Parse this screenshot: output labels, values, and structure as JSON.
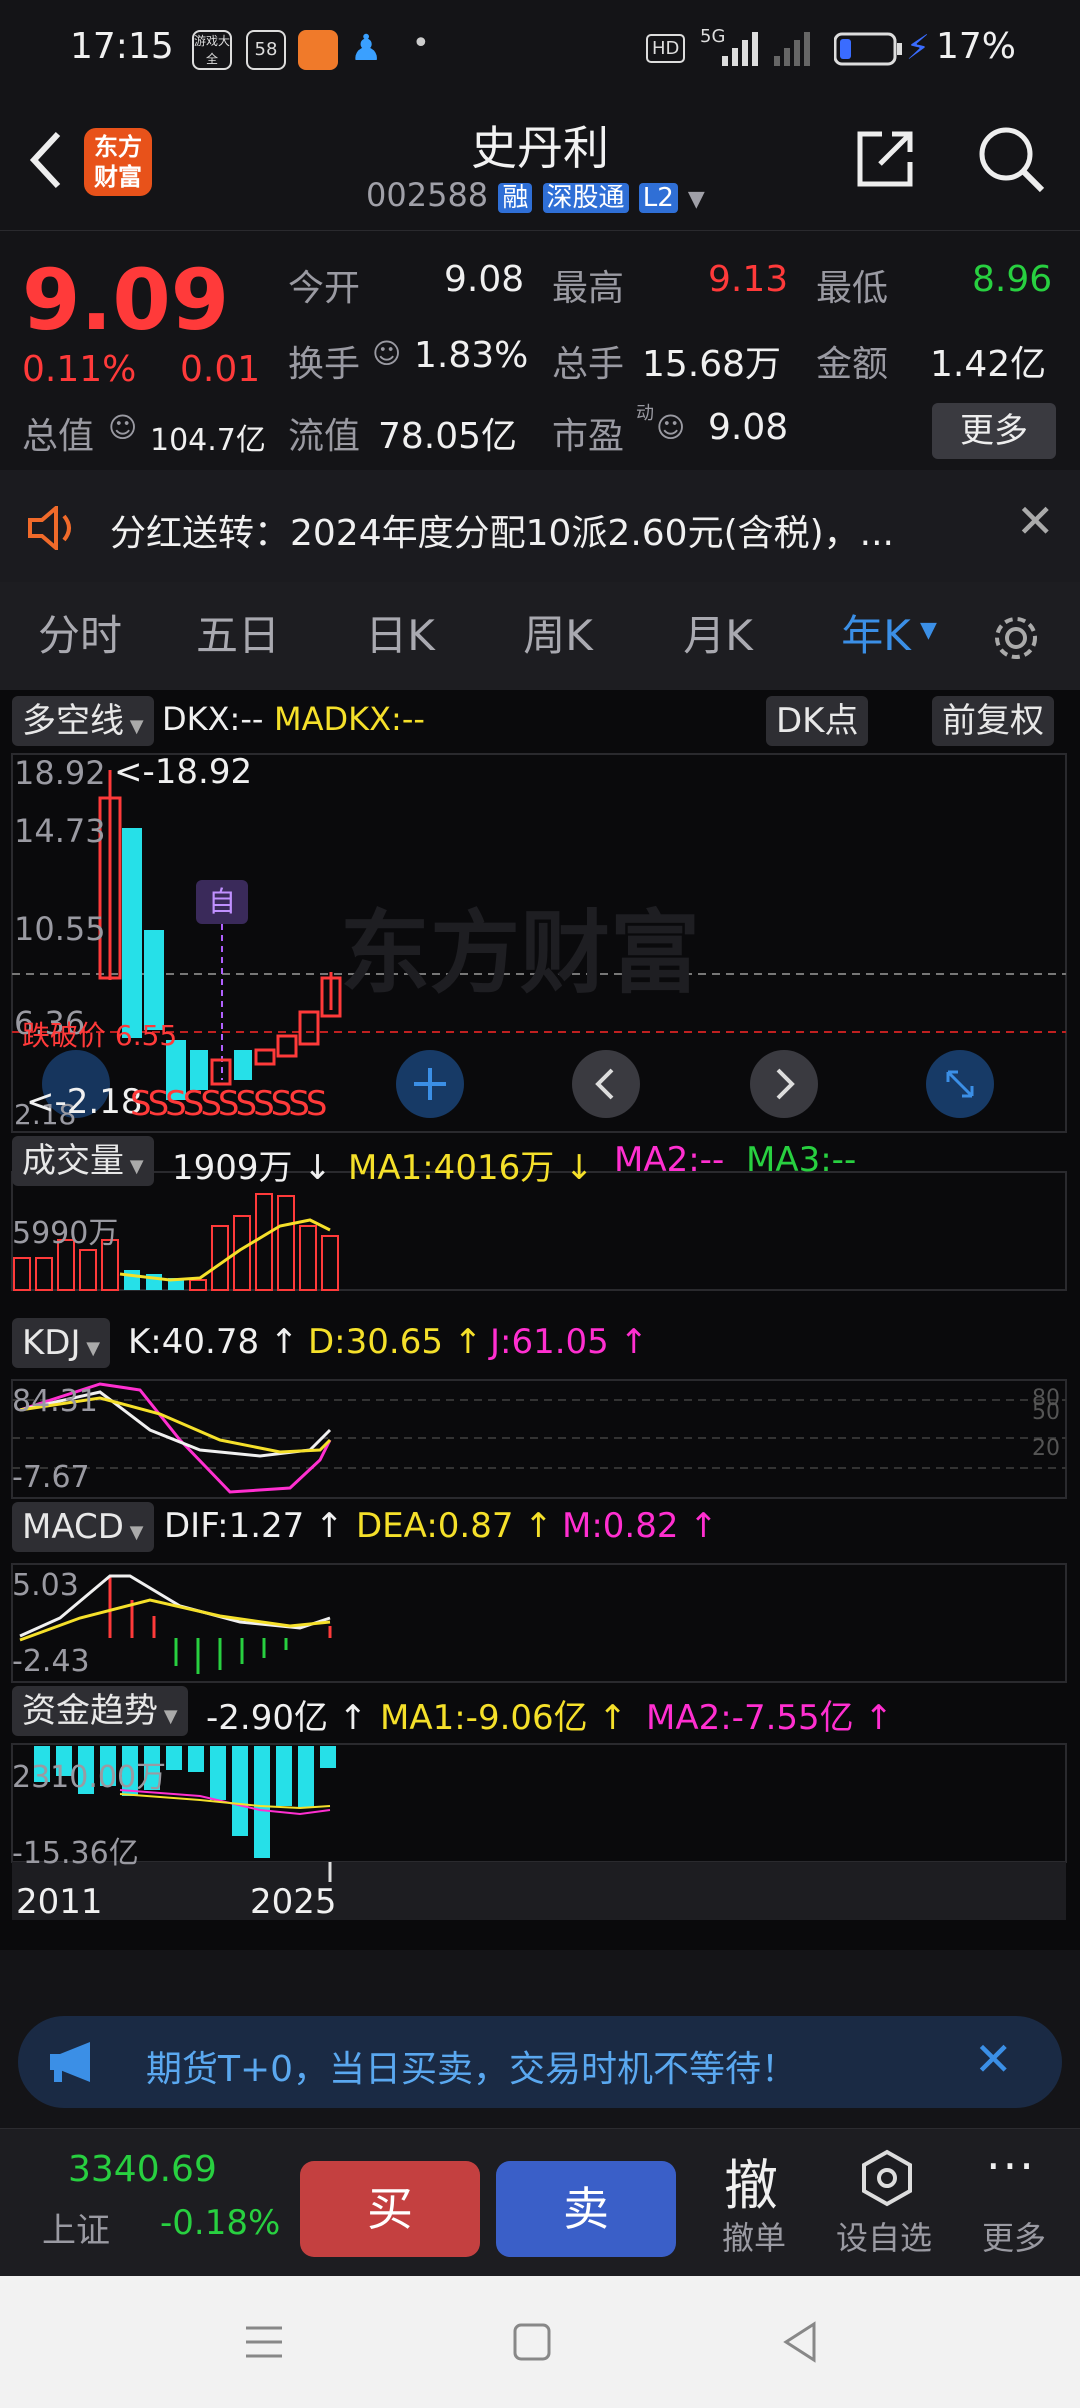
{
  "status": {
    "time": "17:15",
    "battery": "17%",
    "app_badge_1": "游戏大全",
    "app_badge_2": "58",
    "signal": "5G"
  },
  "header": {
    "title": "史丹利",
    "code": "002588",
    "tag_margin": "融",
    "tag_connect": "深股通",
    "tag_level": "L2",
    "logo": "东方财富"
  },
  "quote": {
    "price": "9.09",
    "change_pct": "0.11%",
    "change": "0.01",
    "open_label": "今开",
    "open": "9.08",
    "high_label": "最高",
    "high": "9.13",
    "low_label": "最低",
    "low": "8.96",
    "turnover_label": "换手",
    "turnover": "1.83%",
    "volume_label": "总手",
    "volume": "15.68万",
    "amount_label": "金额",
    "amount": "1.42亿",
    "mktcap_label": "总值",
    "mktcap": "104.7亿",
    "float_label": "流值",
    "float": "78.05亿",
    "pe_label": "市盈",
    "pe_sup": "动",
    "pe": "9.08",
    "more_label": "更多"
  },
  "notice": {
    "text": "分红送转：2024年度分配10派2.60元(含税)，..."
  },
  "tabs": [
    "分时",
    "五日",
    "日K",
    "周K",
    "月K",
    "年K"
  ],
  "chart": {
    "indicator_label": "多空线",
    "dkx": "DKX:--",
    "madkx": "MADKX:--",
    "dk_button": "DK点",
    "adj_button": "前复权",
    "axis": [
      "18.92",
      "14.73",
      "10.55",
      "6.36",
      "2.18"
    ],
    "max_label": "<-18.92",
    "min_label": "<-2.18",
    "break_label": "跌破价 6.55",
    "marker": "自",
    "sell_marks": "SSSSSSSSSSS",
    "watermark": "东方财富"
  },
  "volume": {
    "label": "成交量",
    "value": "1909万",
    "ma1": "MA1:4016万",
    "ma2": "MA2:--",
    "ma3": "MA3:--",
    "axis": "5990万"
  },
  "kdj": {
    "label": "KDJ",
    "k": "K:40.78",
    "d": "D:30.65",
    "j": "J:61.05",
    "axis_top": "84.31",
    "axis_bottom": "-7.67",
    "ref": [
      "80",
      "50",
      "20"
    ]
  },
  "macd": {
    "label": "MACD",
    "dif": "DIF:1.27",
    "dea": "DEA:0.87",
    "m": "M:0.82",
    "axis_top": "5.03",
    "axis_bottom": "-2.43"
  },
  "fund": {
    "label": "资金趋势",
    "value": "-2.90亿",
    "ma1": "MA1:-9.06亿",
    "ma2": "MA2:-7.55亿",
    "axis_top": "2310.00万",
    "axis_bottom": "-15.36亿"
  },
  "xaxis": {
    "start": "2011",
    "end": "2025"
  },
  "promo": {
    "text": "期货T+0，当日买卖，交易时机不等待！"
  },
  "bottom": {
    "index_value": "3340.69",
    "index_name": "上证",
    "index_change": "-0.18%",
    "buy": "买",
    "sell": "卖",
    "cancel_icon": "撤",
    "cancel": "撤单",
    "watch": "设自选",
    "more": "更多"
  },
  "colors": {
    "up": "#ff3a3a",
    "down": "#26e0e8",
    "accent": "#3b8fe6",
    "bg": "#141417"
  }
}
